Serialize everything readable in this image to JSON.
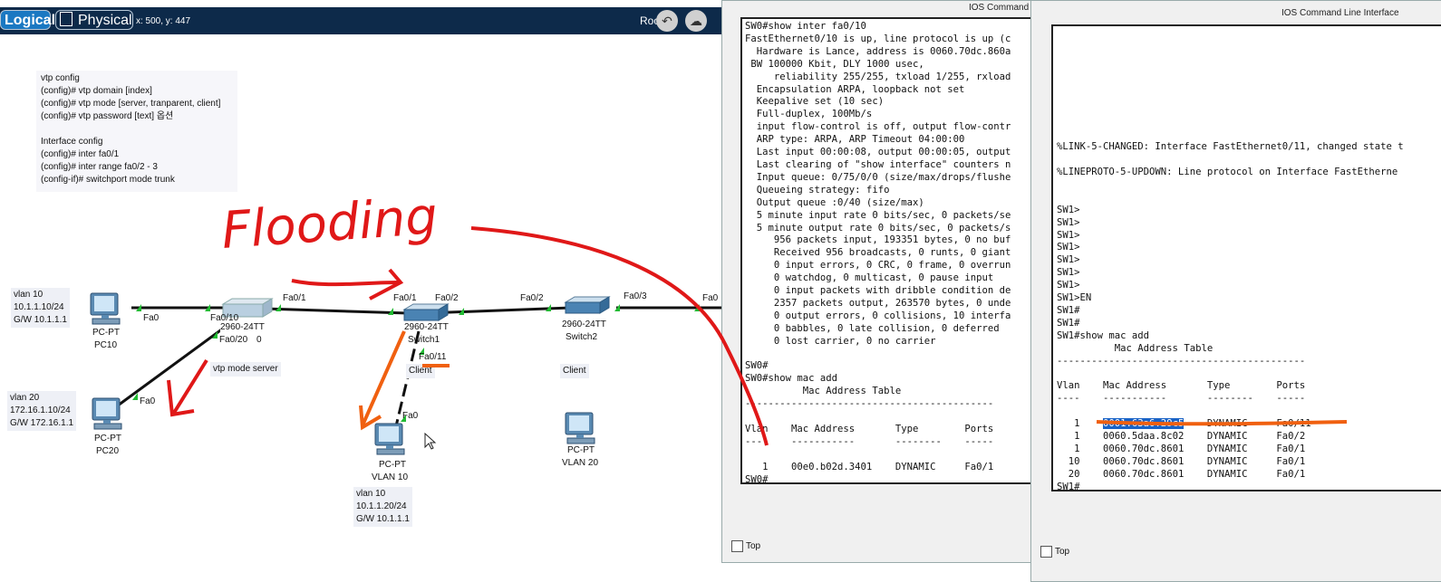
{
  "toolbar": {
    "logical_label": "Logical",
    "physical_label": "Physical",
    "coords": "x: 500, y: 447",
    "root_label": "Root"
  },
  "notes": {
    "lines": [
      "vtp config",
      "(config)# vtp domain [index]",
      "(config)# vtp mode [server, tranparent, client]",
      "(config)# vtp password [text] 옵션",
      "",
      "Interface config",
      "(config)# inter fa0/1",
      "(config)# inter range fa0/2 - 3",
      "(config-if)# switchport mode trunk"
    ]
  },
  "handwriting": {
    "text": "Flooding"
  },
  "topology": {
    "pc10": {
      "type": "PC-PT",
      "name": "PC10",
      "info": [
        "vlan 10",
        "10.1.1.10/24",
        "G/W 10.1.1.1"
      ],
      "port": "Fa0"
    },
    "pc20": {
      "type": "PC-PT",
      "name": "PC20",
      "info": [
        "vlan 20",
        "172.16.1.10/24",
        "G/W 172.16.1.1"
      ],
      "port": "Fa0"
    },
    "pc_vlan10": {
      "type": "PC-PT",
      "name": "VLAN 10",
      "info": [
        "vlan 10",
        "10.1.1.20/24",
        "G/W 10.1.1.1"
      ],
      "port": "Fa0"
    },
    "pc_vlan20": {
      "type": "PC-PT",
      "name": "VLAN 20"
    },
    "switch0": {
      "model": "2960-24TT",
      "name_fragment": "0",
      "mode": "vtp mode server",
      "ports": [
        "Fa0/10",
        "Fa0/20",
        "Fa0/1"
      ]
    },
    "switch1": {
      "model": "2960-24TT",
      "name": "Switch1",
      "mode": "Client",
      "ports": [
        "Fa0/1",
        "Fa0/2",
        "Fa0/11"
      ]
    },
    "switch2": {
      "model": "2960-24TT",
      "name": "Switch2",
      "mode": "Client",
      "ports": [
        "Fa0/2",
        "Fa0/3"
      ]
    },
    "edge_port": "Fa0"
  },
  "window1": {
    "title": "IOS Command",
    "lines": [
      "SW0#show inter fa0/10",
      "FastEthernet0/10 is up, line protocol is up (c",
      "  Hardware is Lance, address is 0060.70dc.860a",
      " BW 100000 Kbit, DLY 1000 usec,",
      "     reliability 255/255, txload 1/255, rxload",
      "  Encapsulation ARPA, loopback not set",
      "  Keepalive set (10 sec)",
      "  Full-duplex, 100Mb/s",
      "  input flow-control is off, output flow-contr",
      "  ARP type: ARPA, ARP Timeout 04:00:00",
      "  Last input 00:00:08, output 00:00:05, output",
      "  Last clearing of \"show interface\" counters n",
      "  Input queue: 0/75/0/0 (size/max/drops/flushe",
      "  Queueing strategy: fifo",
      "  Output queue :0/40 (size/max)",
      "  5 minute input rate 0 bits/sec, 0 packets/se",
      "  5 minute output rate 0 bits/sec, 0 packets/s",
      "     956 packets input, 193351 bytes, 0 no buf",
      "     Received 956 broadcasts, 0 runts, 0 giant",
      "     0 input errors, 0 CRC, 0 frame, 0 overrun",
      "     0 watchdog, 0 multicast, 0 pause input",
      "     0 input packets with dribble condition de",
      "     2357 packets output, 263570 bytes, 0 unde",
      "     0 output errors, 0 collisions, 10 interfa",
      "     0 babbles, 0 late collision, 0 deferred",
      "     0 lost carrier, 0 no carrier",
      "",
      "SW0#",
      "SW0#show mac add",
      "          Mac Address Table",
      "-------------------------------------------",
      "",
      "Vlan    Mac Address       Type        Ports",
      "----    -----------       --------    -----",
      "",
      "   1    00e0.b02d.3401    DYNAMIC     Fa0/1",
      "SW0#"
    ],
    "top_checkbox_label": "Top"
  },
  "window2": {
    "title": "IOS Command Line Interface",
    "lines_before": [
      "",
      "",
      "",
      "",
      "",
      "",
      "",
      "",
      "",
      "%LINK-5-CHANGED: Interface FastEthernet0/11, changed state t",
      "",
      "%LINEPROTO-5-UPDOWN: Line protocol on Interface FastEtherne",
      "",
      "",
      "SW1>",
      "SW1>",
      "SW1>",
      "SW1>",
      "SW1>",
      "SW1>",
      "SW1>",
      "SW1>EN",
      "SW1#",
      "SW1#",
      "SW1#show mac add",
      "          Mac Address Table",
      "-------------------------------------------",
      "",
      "Vlan    Mac Address       Type        Ports",
      "----    -----------       --------    -----",
      ""
    ],
    "mac_rows": [
      {
        "vlan": "1",
        "mac": "0001.63a6.29c5",
        "type": "DYNAMIC",
        "port": "Fa0/11",
        "selected": true
      },
      {
        "vlan": "1",
        "mac": "0060.5daa.8c02",
        "type": "DYNAMIC",
        "port": "Fa0/2",
        "selected": false
      },
      {
        "vlan": "1",
        "mac": "0060.70dc.8601",
        "type": "DYNAMIC",
        "port": "Fa0/1",
        "selected": false
      },
      {
        "vlan": "10",
        "mac": "0060.70dc.8601",
        "type": "DYNAMIC",
        "port": "Fa0/1",
        "selected": false
      },
      {
        "vlan": "20",
        "mac": "0060.70dc.8601",
        "type": "DYNAMIC",
        "port": "Fa0/1",
        "selected": false
      }
    ],
    "prompt_after": "SW1#",
    "top_checkbox_label": "Top"
  },
  "colors": {
    "annotation_red": "#e01818",
    "annotation_orange": "#f06010",
    "toolbar_bg": "#0d2a4a",
    "logical_bg": "#1a78c2",
    "selection": "#1a63c6"
  }
}
